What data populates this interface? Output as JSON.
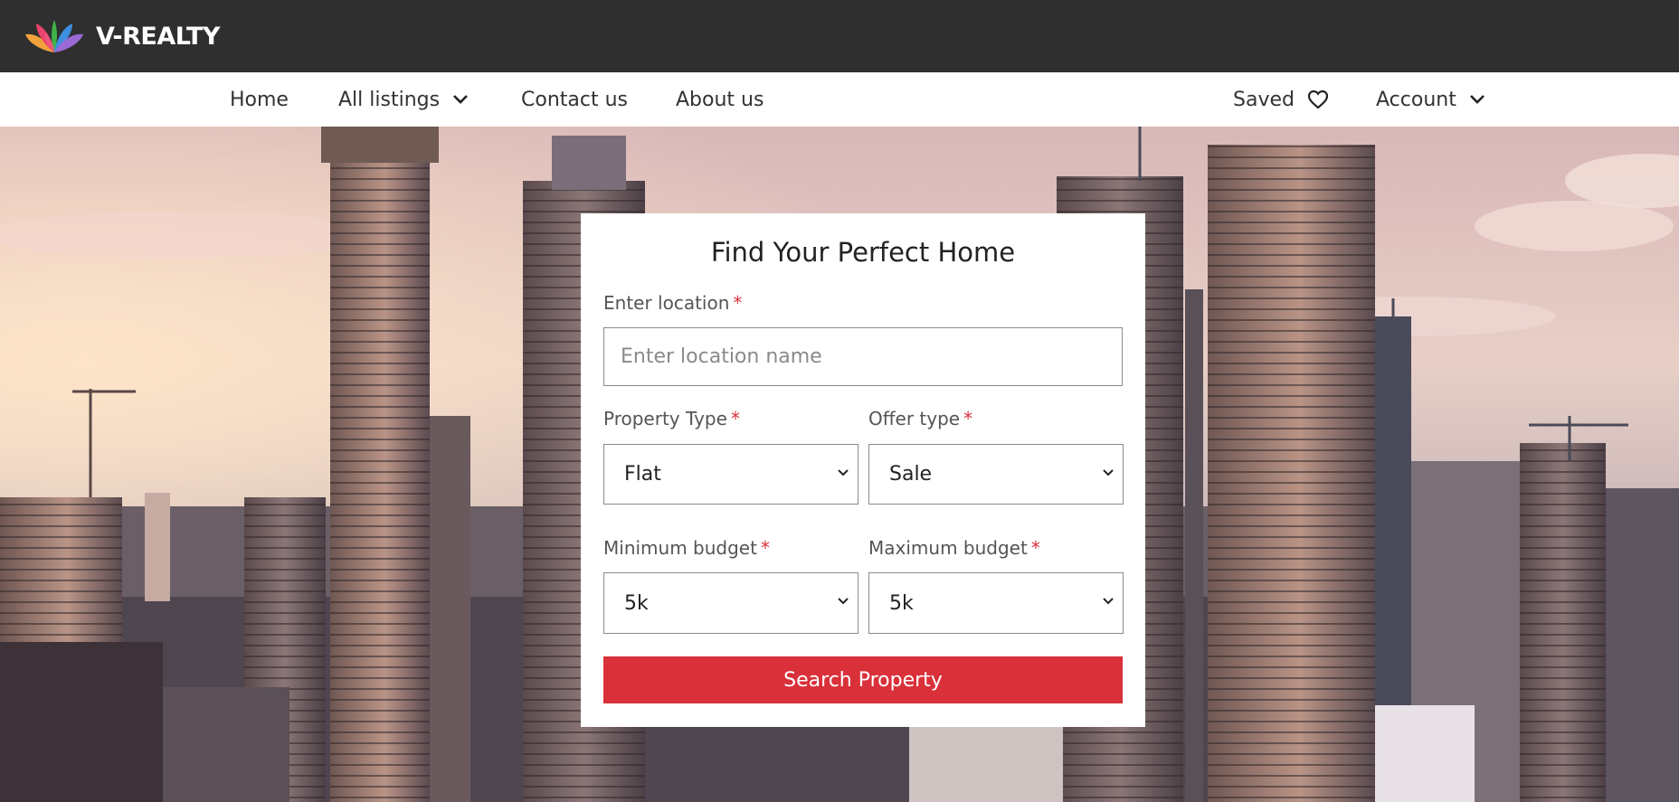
{
  "header": {
    "brand": "V-REALTY",
    "logo_icon": "lotus-logo-icon",
    "bg_color": "#2f2f2f"
  },
  "nav": {
    "home": "Home",
    "all_listings": "All listings",
    "contact": "Contact us",
    "about": "About us",
    "saved": "Saved",
    "account": "Account",
    "icons": {
      "dropdown": "chevron-down-icon",
      "saved": "heart-icon"
    }
  },
  "search": {
    "title": "Find Your Perfect Home",
    "required_mark": "*",
    "location_label": "Enter location",
    "location_placeholder": "Enter location name",
    "location_value": "",
    "property_type_label": "Property Type",
    "property_type_value": "Flat",
    "offer_type_label": "Offer type",
    "offer_type_value": "Sale",
    "min_budget_label": "Minimum budget",
    "min_budget_value": "5k",
    "max_budget_label": "Maximum budget",
    "max_budget_value": "5k",
    "button_label": "Search Property",
    "accent_color": "#d9303a"
  }
}
